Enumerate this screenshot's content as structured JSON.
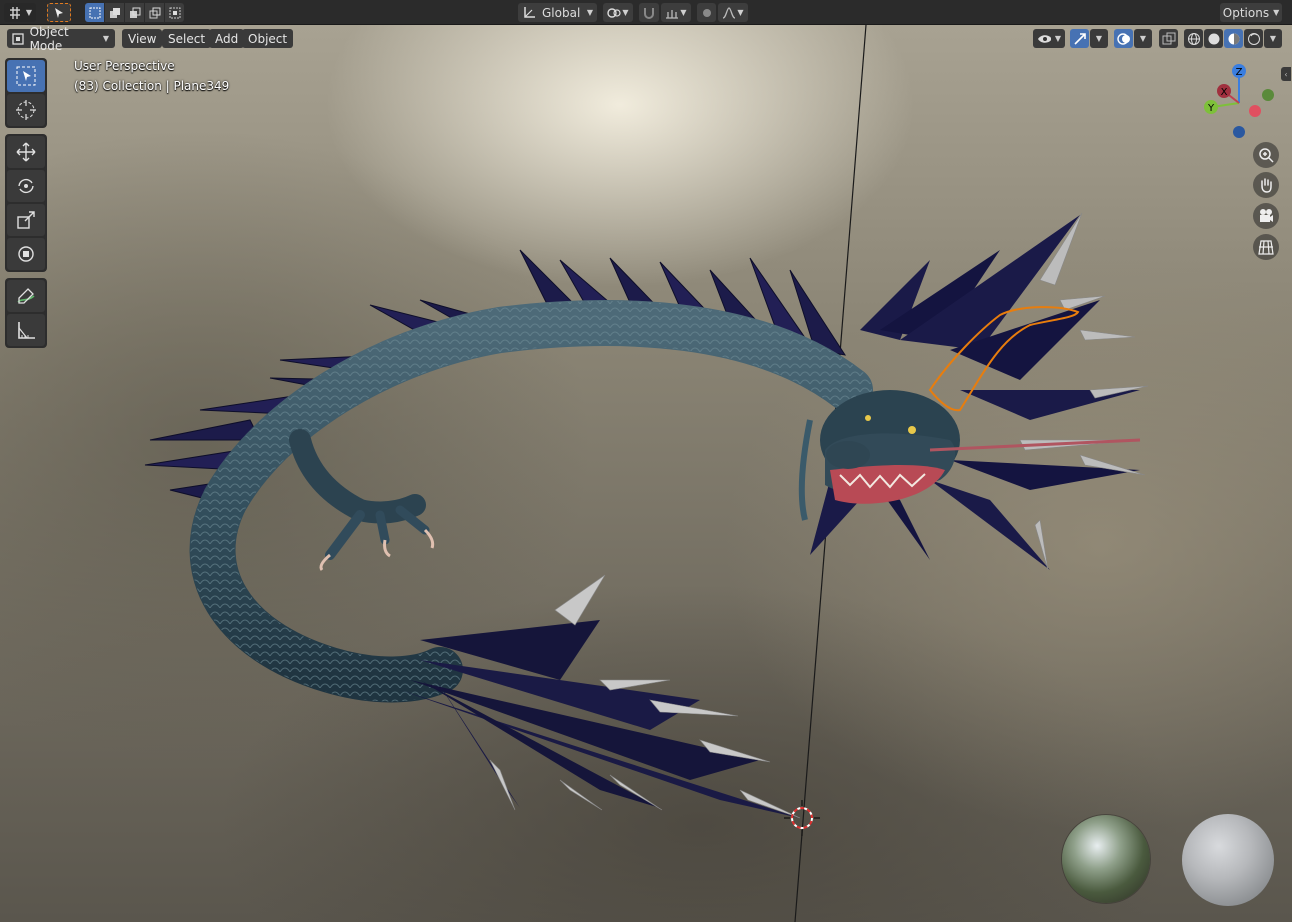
{
  "topbar": {
    "transform_orientation": "Global",
    "options_label": "Options"
  },
  "viewport_header": {
    "mode_label": "Object Mode",
    "menus": [
      "View",
      "Select",
      "Add",
      "Object"
    ]
  },
  "overlay": {
    "view_name": "User Perspective",
    "collection_info": "(83) Collection | Plane349"
  },
  "gizmo": {
    "x_label": "X",
    "y_label": "Y",
    "z_label": "Z"
  },
  "colors": {
    "accent": "#4772b3",
    "header_bg": "#2b2b2b",
    "selection_outline": "#e87d0d"
  },
  "icons": {
    "editor_type": "editor-type-icon",
    "select_box": "select-box-icon",
    "cursor": "cursor-icon",
    "move": "move-icon",
    "rotate": "rotate-icon",
    "scale": "scale-icon",
    "transform": "transform-icon",
    "annotate": "annotate-icon",
    "measure": "measure-icon",
    "zoom": "zoom-icon",
    "pan": "hand-icon",
    "camera": "camera-icon",
    "ortho": "grid-icon"
  }
}
